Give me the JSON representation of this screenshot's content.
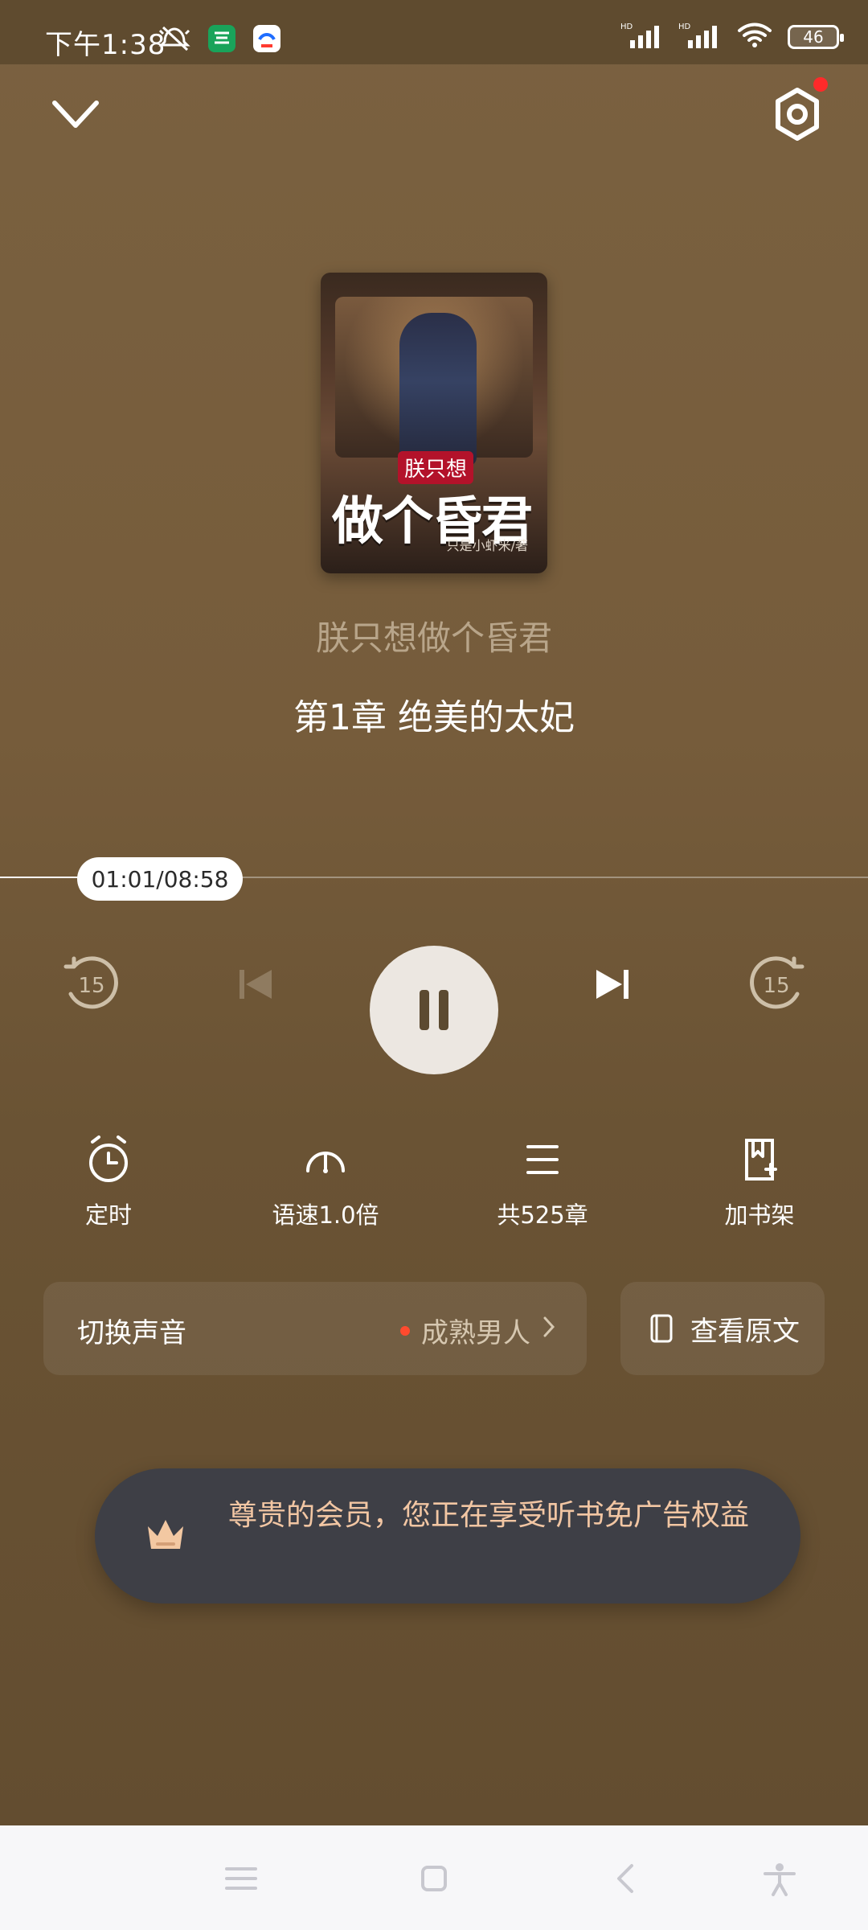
{
  "status_bar": {
    "time": "下午1:38",
    "battery": "46"
  },
  "player": {
    "book_title": "朕只想做个昏君",
    "chapter_title": "第1章 绝美的太妃",
    "time_display": "01:01/08:58",
    "progress_fraction": 0.116,
    "cover": {
      "small_title": "朕只想",
      "big_title": "做个昏君",
      "author": "只是小虾米/著"
    },
    "features": {
      "timer": "定时",
      "speed": "语速1.0倍",
      "chapters": "共525章",
      "bookshelf": "加书架"
    },
    "voice": {
      "label": "切换声音",
      "selected": "成熟男人"
    },
    "view_original": "查看原文",
    "toast": "尊贵的会员，您正在享受听书免广告权益"
  },
  "icons": {
    "collapse": "chevron-down-icon",
    "settings": "hexagon-settings-icon",
    "rewind": "rewind-15-icon",
    "prev": "skip-previous-icon",
    "pause": "pause-icon",
    "next": "skip-next-icon",
    "forward": "forward-15-icon",
    "timer": "alarm-clock-icon",
    "speed": "speedometer-icon",
    "chapters": "list-icon",
    "bookshelf": "bookmark-add-icon",
    "original": "book-icon",
    "crown": "crown-icon"
  },
  "colors": {
    "accent_red": "#ff4a2e",
    "toast_text": "#f2c6a3",
    "background": "#765c3b"
  }
}
